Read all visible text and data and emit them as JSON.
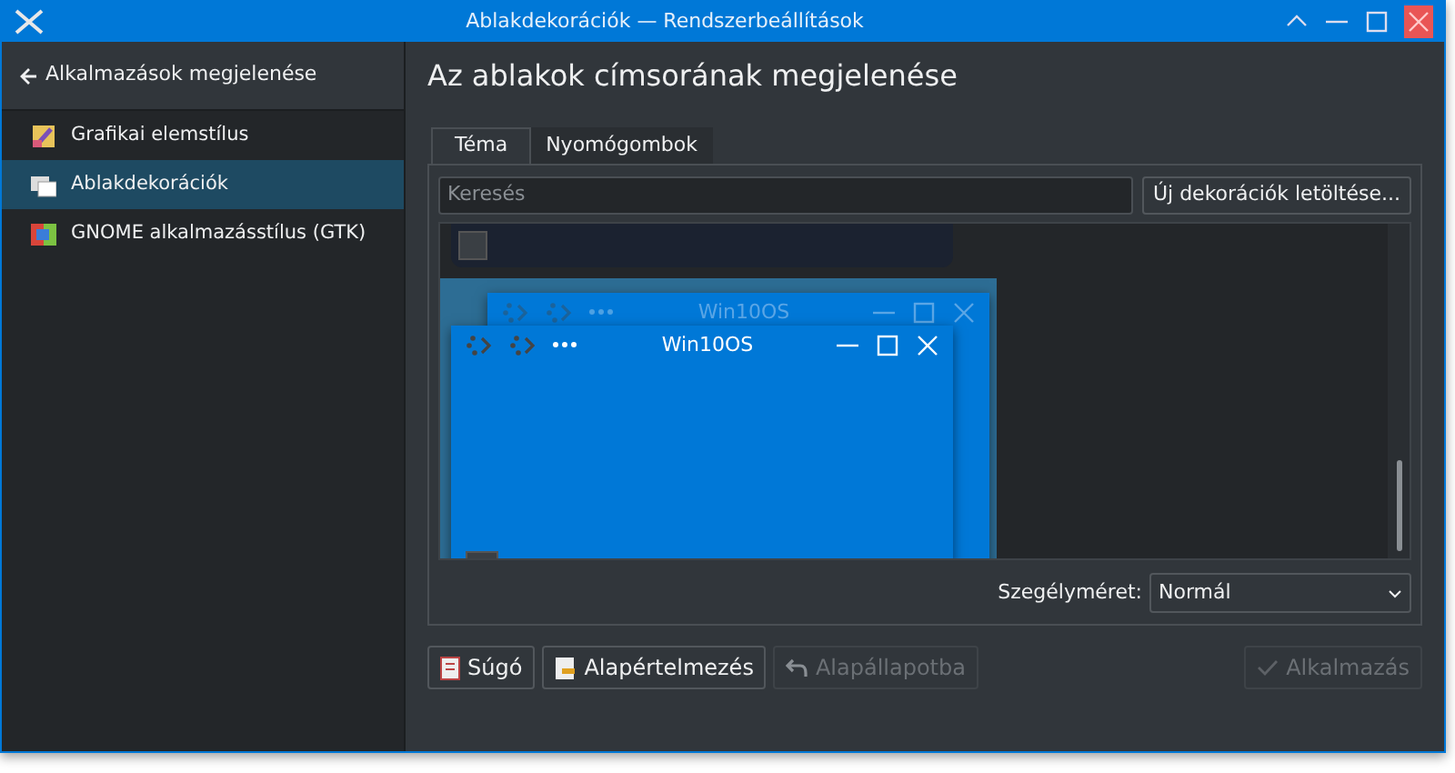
{
  "window": {
    "title": "Ablakdekorációk — Rendszerbeállítások"
  },
  "sidebar": {
    "header": "Alkalmazások megjelenése",
    "items": [
      {
        "label": "Grafikai elemstílus",
        "selected": false
      },
      {
        "label": "Ablakdekorációk",
        "selected": true
      },
      {
        "label": "GNOME alkalmazásstílus (GTK)",
        "selected": false
      }
    ]
  },
  "page_title": "Az ablakok címsorának megjelenése",
  "tabs": [
    {
      "label": "Téma",
      "selected": true
    },
    {
      "label": "Nyomógombok",
      "selected": false
    }
  ],
  "search": {
    "placeholder": "Keresés"
  },
  "get_new_button": "Új dekorációk letöltése...",
  "decorations": [
    {
      "selected": false
    },
    {
      "selected": true,
      "inactive_title": "Win10OS",
      "active_title": "Win10OS"
    }
  ],
  "border_size": {
    "label": "Szegélyméret:",
    "value": "Normál"
  },
  "footer_buttons": [
    {
      "label": "Súgó",
      "kind": "help",
      "disabled": false
    },
    {
      "label": "Alapértelmezés",
      "kind": "defaults",
      "disabled": false
    },
    {
      "label": "Alapállapotba",
      "kind": "reset",
      "disabled": true
    },
    {
      "label": "Alkalmazás",
      "kind": "apply",
      "disabled": true
    }
  ]
}
